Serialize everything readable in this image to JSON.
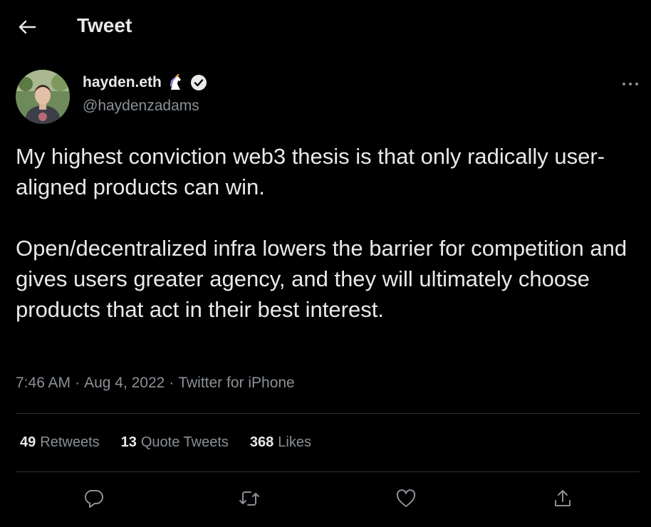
{
  "header": {
    "back_icon": "arrow-left-icon",
    "title": "Tweet"
  },
  "author": {
    "display_name": "hayden.eth",
    "handle": "@haydenzadams",
    "badges": [
      "unicorn-icon",
      "verified-icon"
    ]
  },
  "tweet": {
    "paragraphs": [
      "My highest conviction web3 thesis is that only radically user-aligned products can win.",
      "Open/decentralized infra lowers the barrier for competition and gives users greater agency, and they will ultimately choose products that act in their best interest."
    ],
    "time": "7:46 AM",
    "date": "Aug 4, 2022",
    "source": "Twitter for iPhone",
    "separator": "·"
  },
  "stats": {
    "retweets": {
      "count": "49",
      "label": "Retweets"
    },
    "quotes": {
      "count": "13",
      "label": "Quote Tweets"
    },
    "likes": {
      "count": "368",
      "label": "Likes"
    }
  },
  "actions": [
    "reply-icon",
    "retweet-icon",
    "like-icon",
    "share-icon"
  ],
  "colors": {
    "background": "#000000",
    "text": "#e7e9ea",
    "secondary": "#8b9096",
    "divider": "#2f3336"
  }
}
